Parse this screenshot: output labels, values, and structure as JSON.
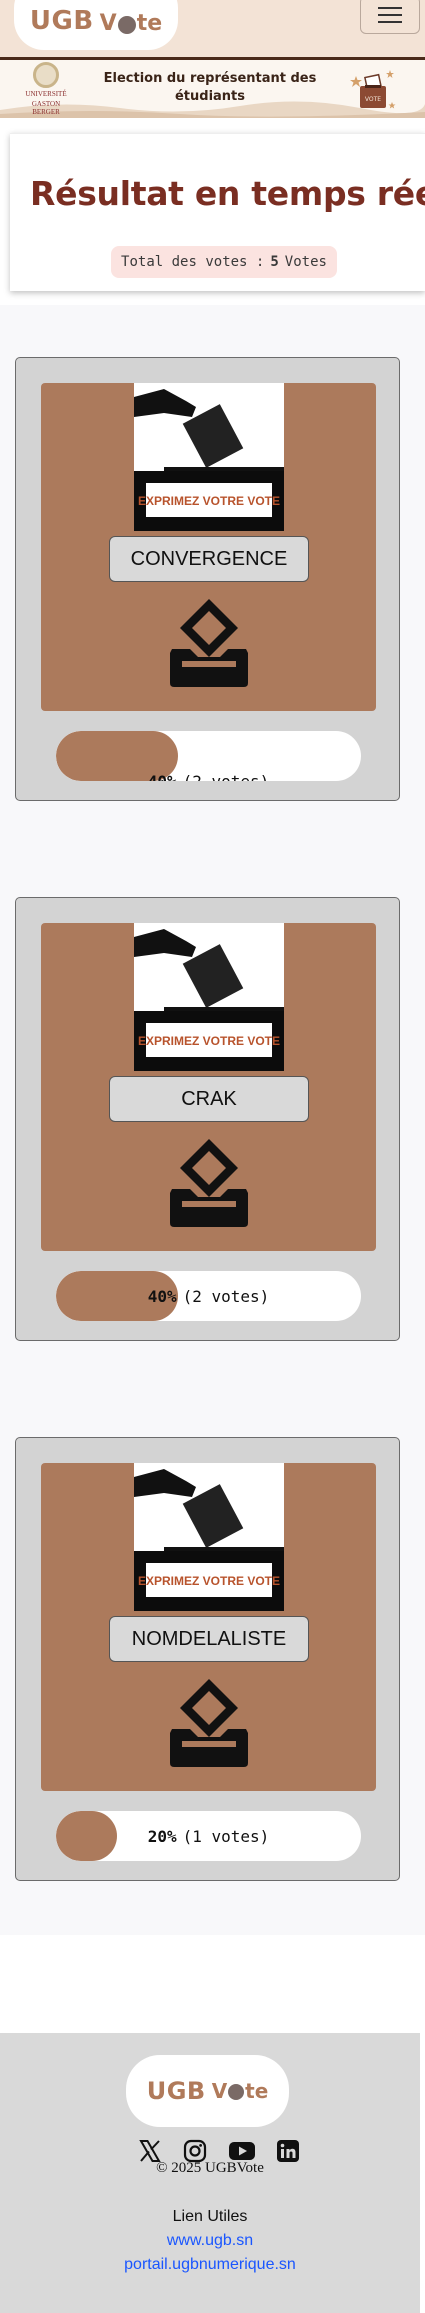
{
  "header": {
    "logo_ugb": "UGB",
    "logo_vote_v": "V",
    "logo_vote_te": "te"
  },
  "banner": {
    "university_line1": "UNIVERSITÉ",
    "university_line2": "GASTON BERGER",
    "title": "Election du représentant des étudiants",
    "ballot_label": "VOTE"
  },
  "results": {
    "title": "Résultat en temps réel",
    "total_prefix": "Total des votes :",
    "total_count": "5",
    "total_suffix": "Votes"
  },
  "candidates": [
    {
      "name": "CONVERGENCE",
      "image_caption": "EXPRIMEZ VOTRE VOTE",
      "percent_text": "40%",
      "votes_text": "(2 votes)",
      "fraction": 0.4
    },
    {
      "name": "CRAK",
      "image_caption": "EXPRIMEZ VOTRE VOTE",
      "percent_text": "40%",
      "votes_text": "(2 votes)",
      "fraction": 0.4
    },
    {
      "name": "NOMDELALISTE",
      "image_caption": "EXPRIMEZ VOTRE VOTE",
      "percent_text": "20%",
      "votes_text": "(1 votes)",
      "fraction": 0.2
    }
  ],
  "footer": {
    "logo_ugb": "UGB",
    "logo_vote_v": "V",
    "logo_vote_te": "te",
    "social_icons": [
      "x-icon",
      "instagram-icon",
      "youtube-icon",
      "linkedin-icon"
    ],
    "copyright": "© 2025 UGBVote",
    "links_title": "Lien Utiles",
    "links": [
      "www.ugb.sn",
      "portail.ugbnumerique.sn"
    ]
  },
  "colors": {
    "accent_brown": "#ac7a5c",
    "title_red": "#7a2e22",
    "link_blue": "#1a56ff"
  }
}
